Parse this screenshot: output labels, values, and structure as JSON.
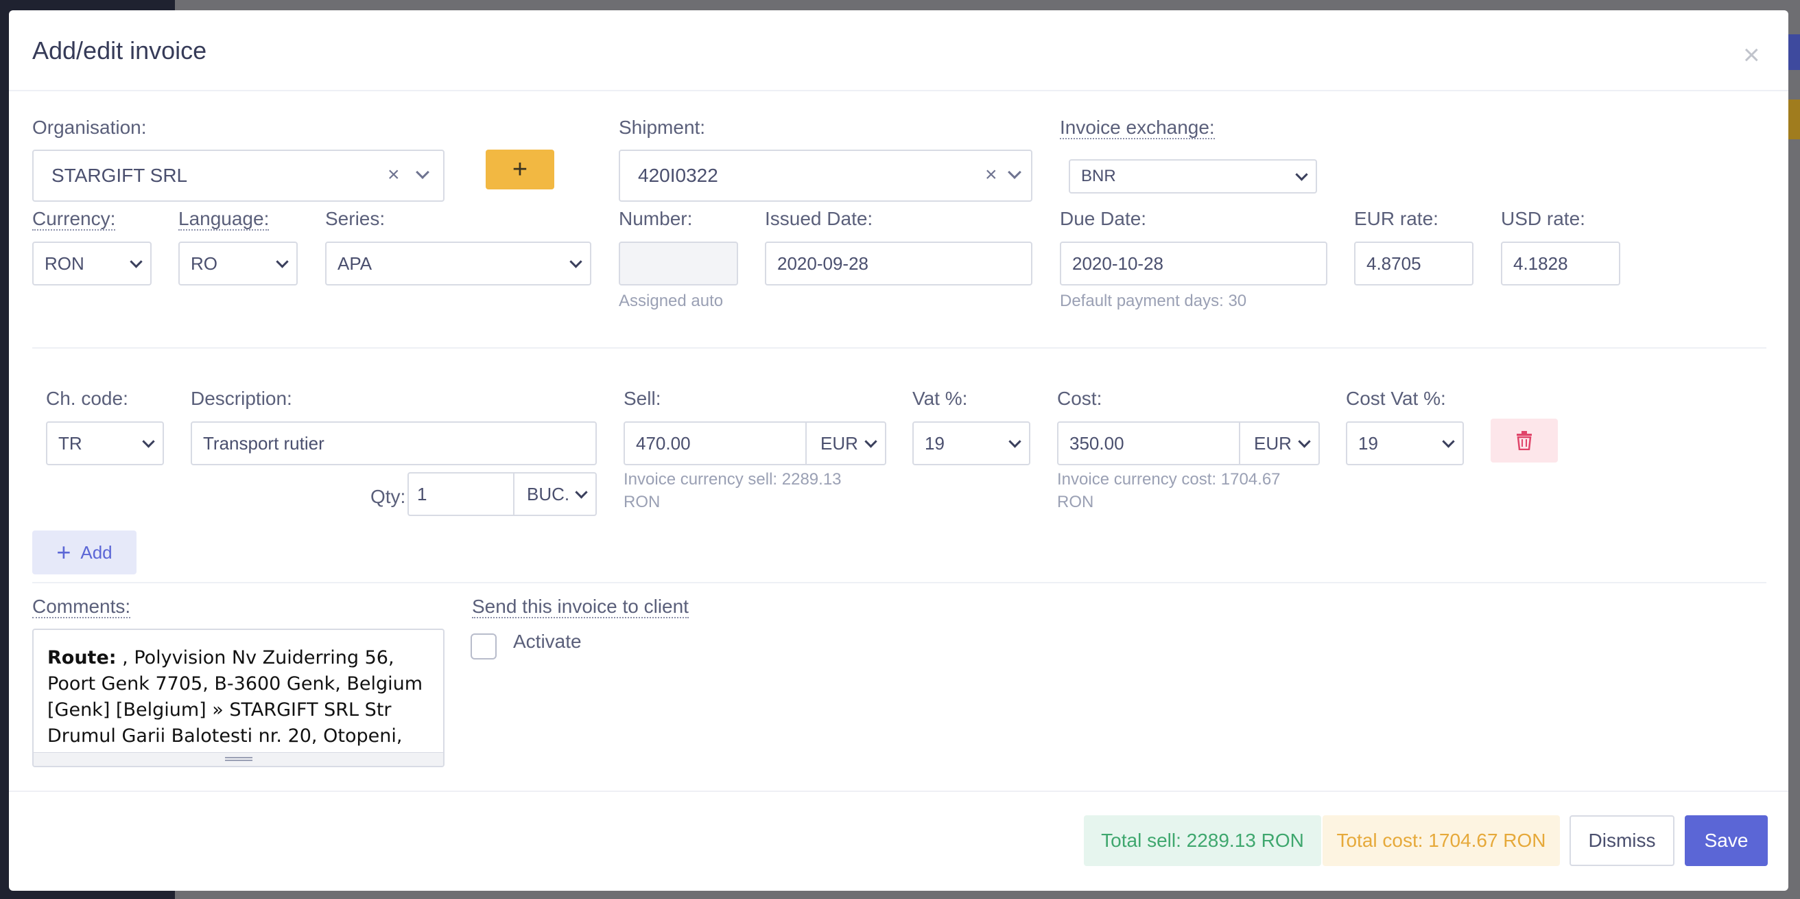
{
  "modal": {
    "title": "Add/edit invoice",
    "close_icon": "×"
  },
  "organisation": {
    "label": "Organisation:",
    "value": "STARGIFT SRL"
  },
  "shipment": {
    "label": "Shipment:",
    "value": "420I0322"
  },
  "invoice_exchange": {
    "label": "Invoice exchange:",
    "value": "BNR"
  },
  "currency": {
    "label": "Currency:",
    "value": "RON"
  },
  "language": {
    "label": "Language:",
    "value": "RO"
  },
  "series": {
    "label": "Series:",
    "value": "APA"
  },
  "number": {
    "label": "Number:",
    "value": "",
    "hint": "Assigned auto"
  },
  "issued_date": {
    "label": "Issued Date:",
    "value": "2020-09-28"
  },
  "due_date": {
    "label": "Due Date:",
    "value": "2020-10-28",
    "hint": "Default payment days: 30"
  },
  "eur_rate": {
    "label": "EUR rate:",
    "value": "4.8705"
  },
  "usd_rate": {
    "label": "USD rate:",
    "value": "4.1828"
  },
  "line": {
    "ch_code": {
      "label": "Ch. code:",
      "value": "TR"
    },
    "description": {
      "label": "Description:",
      "value": "Transport rutier"
    },
    "qty": {
      "label": "Qty:",
      "value": "1",
      "unit": "BUC."
    },
    "sell": {
      "label": "Sell:",
      "value": "470.00",
      "currency": "EUR",
      "hint_line1": "Invoice currency sell: 2289.13",
      "hint_line2": "RON"
    },
    "vat": {
      "label": "Vat %:",
      "value": "19"
    },
    "cost": {
      "label": "Cost:",
      "value": "350.00",
      "currency": "EUR",
      "hint_line1": "Invoice currency cost: 1704.67",
      "hint_line2": "RON"
    },
    "cost_vat": {
      "label": "Cost Vat %:",
      "value": "19"
    }
  },
  "add_button": {
    "label": "Add",
    "icon": "+"
  },
  "comments": {
    "label": "Comments:",
    "route_label": "Route:",
    "route_text": " , Polyvision Nv Zuiderring 56, Poort Genk 7705, B-3600 Genk, Belgium [Genk] [Belgium] » STARGIFT SRL Str Drumul Garii Balotesti nr. 20, Otopeni, Ilfov, ROMANIA"
  },
  "send_invoice": {
    "label": "Send this invoice to client",
    "checkbox_label": "Activate"
  },
  "footer": {
    "total_sell": "Total sell: 2289.13 RON",
    "total_cost": "Total cost: 1704.67 RON",
    "dismiss": "Dismiss",
    "save": "Save"
  },
  "plus_button_icon": "+",
  "icons": {
    "trash": "trash-icon",
    "clear": "×"
  },
  "colors": {
    "accent": "#5b66d6",
    "warning": "#f2b842",
    "success": "#3fa76e",
    "danger": "#e0456a"
  }
}
